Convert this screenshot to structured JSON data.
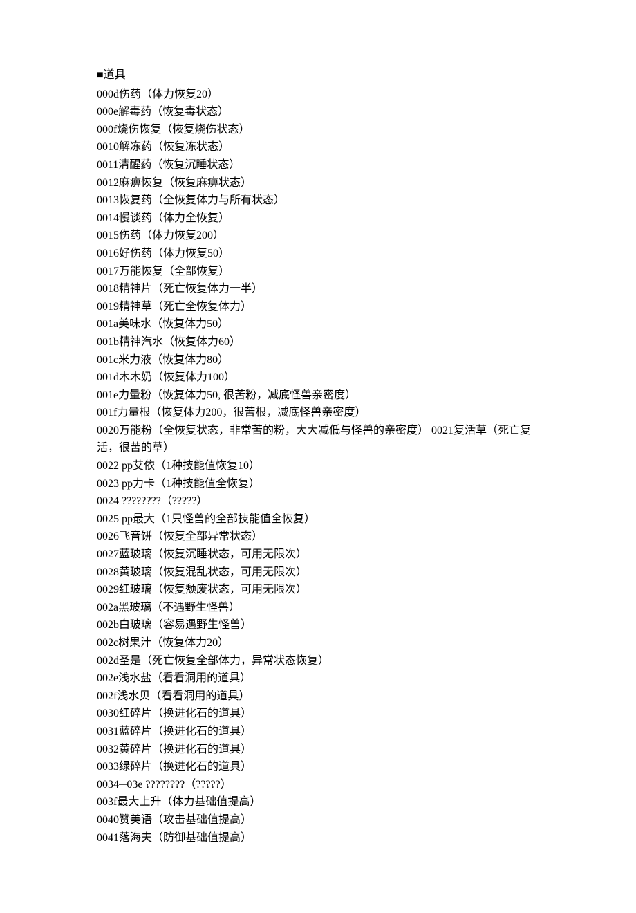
{
  "header": "■道具",
  "items": [
    "000d伤药（体力恢复20）",
    "000e解毒药（恢复毒状态）",
    "000f烧伤恢复（恢复烧伤状态）",
    "0010解冻药（恢复冻状态）",
    "0011清醒药（恢复沉睡状态）",
    "0012麻痹恢复（恢复麻痹状态）",
    "0013恢复药（全恢复体力与所有状态）",
    "0014慢谈药（体力全恢复）",
    "0015伤药（体力恢复200）",
    "0016好伤药（体力恢复50）",
    "0017万能恢复（全部恢复）",
    "0018精神片（死亡恢复体力一半）",
    "0019精神草（死亡全恢复体力）",
    "001a美味水（恢复体力50）",
    "001b精神汽水（恢复体力60）",
    "001c米力液（恢复体力80）",
    "001d木木奶（恢复体力100）",
    "001e力量粉（恢复体力50, 很苦粉，减底怪兽亲密度）",
    "001f力量根（恢复体力200，很苦根，减底怪兽亲密度）",
    "0020万能粉（全恢复状态，非常苦的粉，大大减低与怪兽的亲密度） 0021复活草（死亡复活，很苦的草）",
    "0022 pp艾依（1种技能值恢复10）",
    "0023 pp力卡（1种技能值全恢复）",
    "0024 ????????（?????）",
    "0025 pp最大（1只怪兽的全部技能值全恢复）",
    "0026飞音饼（恢复全部异常状态）",
    "0027蓝玻璃（恢复沉睡状态，可用无限次）",
    "0028黄玻璃（恢复混乱状态，可用无限次）",
    "0029红玻璃（恢复颓废状态，可用无限次）",
    "002a黑玻璃（不遇野生怪兽）",
    "002b白玻璃（容易遇野生怪兽）",
    "002c树果汁（恢复体力20）",
    "002d圣是（死亡恢复全部体力，异常状态恢复）",
    "002e浅水盐（看看洞用的道具）",
    "002f浅水贝（看看洞用的道具）",
    "0030红碎片（换进化石的道具）",
    "0031蓝碎片（换进化石的道具）",
    "0032黄碎片（换进化石的道具）",
    "0033绿碎片（换进化石的道具）",
    "0034─03e ????????（?????）",
    "003f最大上升（体力基础值提高）",
    "0040赞美语（攻击基础值提高）",
    "0041落海夫（防御基础值提高）"
  ]
}
